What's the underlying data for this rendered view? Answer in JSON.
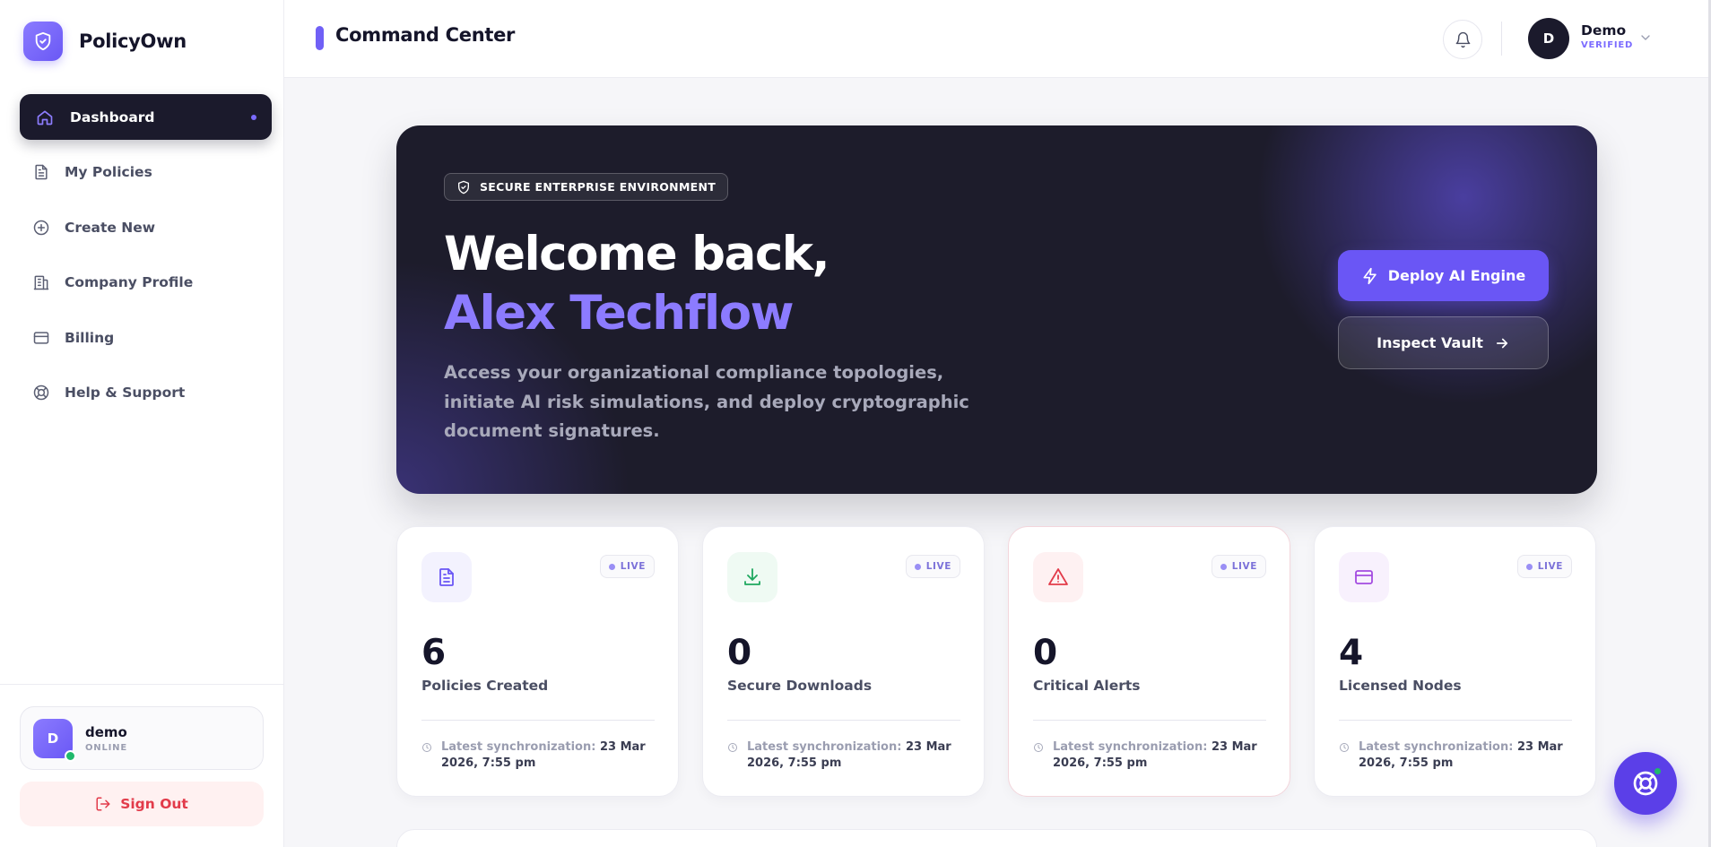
{
  "brand": {
    "name": "PolicyOwn"
  },
  "sidebar": {
    "items": [
      {
        "label": "Dashboard",
        "icon": "home-icon",
        "active": true
      },
      {
        "label": "My Policies",
        "icon": "document-icon"
      },
      {
        "label": "Create New",
        "icon": "plus-circle-icon"
      },
      {
        "label": "Company Profile",
        "icon": "building-icon"
      },
      {
        "label": "Billing",
        "icon": "credit-card-icon"
      },
      {
        "label": "Help & Support",
        "icon": "lifebuoy-icon"
      }
    ],
    "user": {
      "initial": "D",
      "name": "demo",
      "status": "ONLINE"
    },
    "sign_out_label": "Sign Out"
  },
  "header": {
    "title": "Command Center",
    "user": {
      "initial": "D",
      "name": "Demo",
      "badge": "VERIFIED"
    }
  },
  "hero": {
    "badge": "SECURE ENTERPRISE ENVIRONMENT",
    "line1": "Welcome back,",
    "line2": "Alex Techflow",
    "description": "Access your organizational compliance topologies, initiate AI risk simulations, and deploy cryptographic document signatures.",
    "primary_button": "Deploy AI Engine",
    "secondary_button": "Inspect Vault"
  },
  "stats": [
    {
      "value": "6",
      "label": "Policies Created",
      "live": "LIVE",
      "sync_label": "Latest synchronization:",
      "sync_value": "23 Mar 2026, 7:55 pm",
      "icon": "document-icon",
      "color": "#6a56f5"
    },
    {
      "value": "0",
      "label": "Secure Downloads",
      "live": "LIVE",
      "sync_label": "Latest synchronization:",
      "sync_value": "23 Mar 2026, 7:55 pm",
      "icon": "download-icon",
      "color": "#1fa85f"
    },
    {
      "value": "0",
      "label": "Critical Alerts",
      "live": "LIVE",
      "sync_label": "Latest synchronization:",
      "sync_value": "23 Mar 2026, 7:55 pm",
      "icon": "warning-icon",
      "color": "#e23b4a"
    },
    {
      "value": "4",
      "label": "Licensed Nodes",
      "live": "LIVE",
      "sync_label": "Latest synchronization:",
      "sync_value": "23 Mar 2026, 7:55 pm",
      "icon": "credit-card-icon",
      "color": "#a34be0"
    }
  ],
  "colors": {
    "accent": "#6a56f5",
    "dark": "#1d1c2b",
    "danger": "#e23b4a",
    "success": "#1fb96b"
  }
}
